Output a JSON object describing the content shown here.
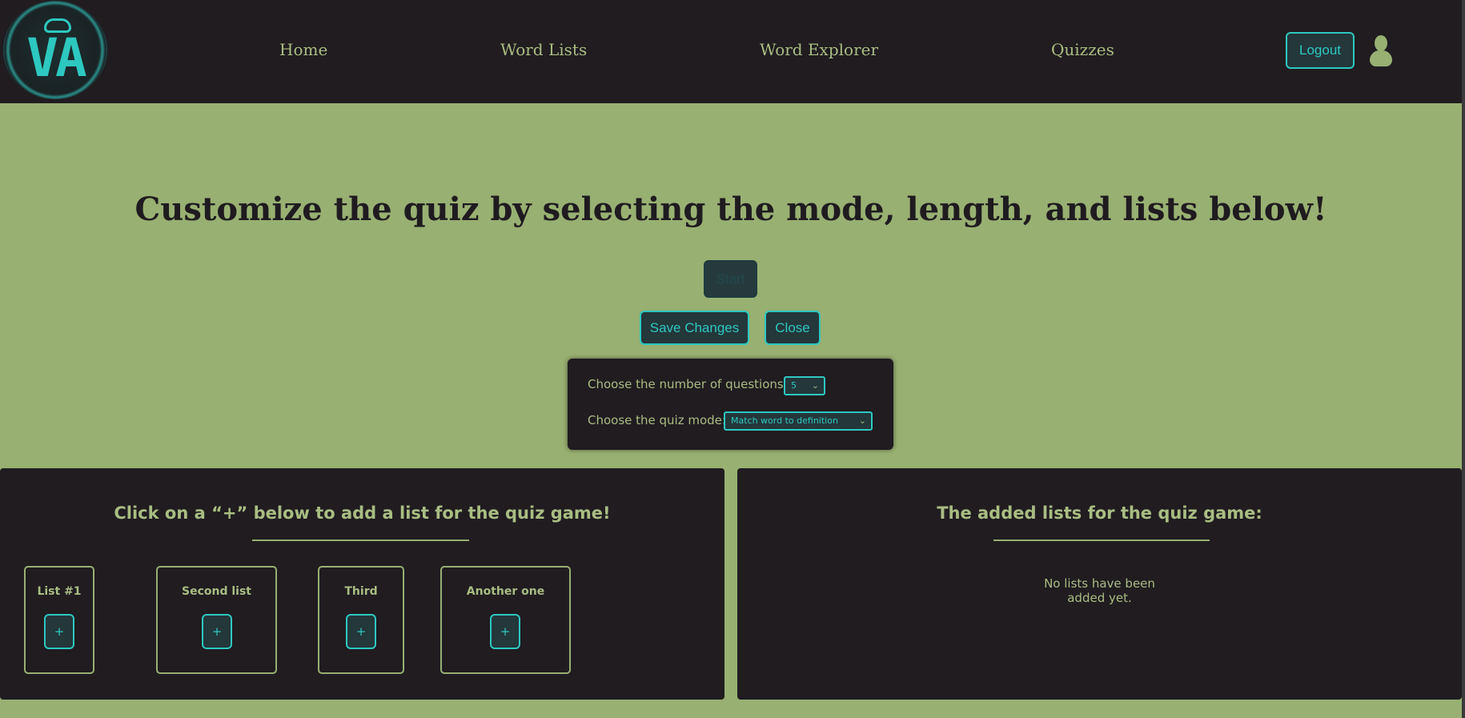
{
  "nav": {
    "logo_text": "VA",
    "links": [
      "Home",
      "Word Lists",
      "Word Explorer",
      "Quizzes"
    ],
    "logout_label": "Logout"
  },
  "main": {
    "headline": "Customize the quiz by selecting the mode, length, and lists below!",
    "start_label": "Start",
    "save_label": "Save Changes",
    "close_label": "Close"
  },
  "settings": {
    "questions_label": "Choose the number of questions:",
    "questions_value": "5",
    "mode_label": "Choose the quiz mode:",
    "mode_value": "Match word to definition"
  },
  "left_panel": {
    "title": "Click on a “+” below to add a list for the quiz game!",
    "lists": [
      {
        "name": "List #1",
        "add_label": "+"
      },
      {
        "name": "Second list",
        "add_label": "+"
      },
      {
        "name": "Third",
        "add_label": "+"
      },
      {
        "name": "Another one",
        "add_label": "+"
      }
    ]
  },
  "right_panel": {
    "title": "The added lists for the quiz game:",
    "empty_message": "No lists have been\nadded yet."
  },
  "colors": {
    "page_bg": "#98b072",
    "dark_bg": "#201c20",
    "accent": "#2dc8c0",
    "text_green": "#a9bd82"
  }
}
